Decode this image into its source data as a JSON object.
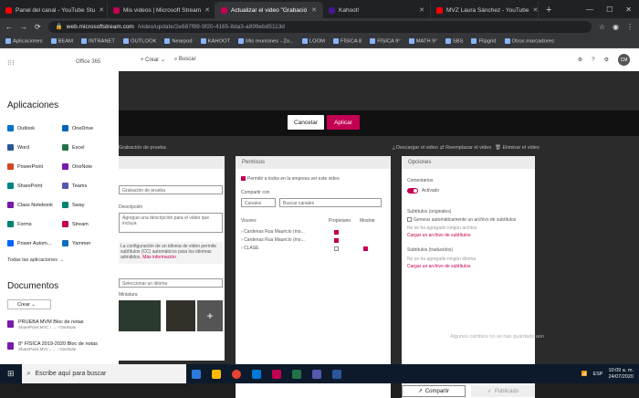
{
  "browser": {
    "tabs": [
      {
        "title": "Panel del canal - YouTube Stu",
        "color": "#ff0000",
        "active": false
      },
      {
        "title": "Mis videos | Microsoft Stream",
        "color": "#c30052",
        "active": false
      },
      {
        "title": "Actualizar el video \"Grabació",
        "color": "#c30052",
        "active": true
      },
      {
        "title": "Kahoot!",
        "color": "#46178f",
        "active": false
      },
      {
        "title": "MVZ Laura Sánchez - YouTube",
        "color": "#ff0000",
        "active": false
      }
    ],
    "url_host": "web.microsoftstream.com",
    "url_path": "/video/update/2e887f89-9f20-4165-8da3-a899ebd5113d",
    "bookmarks": [
      "Aplicaciones",
      "BEAM",
      "INTRANET",
      "OUTLOOK",
      "Nearpod",
      "KAHOOT",
      "Mis reuniones - Zo...",
      "LOOM",
      "FÍSICA 8",
      "FÍSICA 9°",
      "MATH 9°",
      "SBS",
      "Flipgrid",
      "Otros marcadores"
    ]
  },
  "app_launcher": {
    "brand": "Office 365",
    "apps_title": "Aplicaciones",
    "apps": [
      {
        "name": "Outlook",
        "color": "#0072c6"
      },
      {
        "name": "OneDrive",
        "color": "#0364b8"
      },
      {
        "name": "Word",
        "color": "#2b579a"
      },
      {
        "name": "Excel",
        "color": "#217346"
      },
      {
        "name": "PowerPoint",
        "color": "#d24726"
      },
      {
        "name": "OneNote",
        "color": "#7719aa"
      },
      {
        "name": "SharePoint",
        "color": "#038387"
      },
      {
        "name": "Teams",
        "color": "#5558af"
      },
      {
        "name": "Class Notebook",
        "color": "#7719aa"
      },
      {
        "name": "Sway",
        "color": "#008272"
      },
      {
        "name": "Forms",
        "color": "#008272"
      },
      {
        "name": "Stream",
        "color": "#c30052"
      },
      {
        "name": "Power Autom...",
        "color": "#0066ff"
      },
      {
        "name": "Yammer",
        "color": "#106ebe"
      }
    ],
    "all_apps": "Todas las aplicaciones",
    "docs_title": "Documentos",
    "create_label": "Crear",
    "docs": [
      {
        "name": "PRUEBA MVM Bloc de notas",
        "meta": "SharePoint MVC › ... › OneNote"
      },
      {
        "name": "8° FÍSICA 2019-2020 Bloc de notas",
        "meta": "SharePoint MVC › ... › OneNote"
      }
    ]
  },
  "stream": {
    "create": "Crear",
    "search_placeholder": "Buscar",
    "cancel": "Cancelar",
    "apply": "Aplicar",
    "video_title": "Grabación de prueba",
    "download": "Descargar el video",
    "replace": "Reemplazar el video",
    "delete": "Eliminar el video",
    "details": {
      "name_value": "Grabación de prueba",
      "desc_label": "Descripción",
      "desc_placeholder": "Agregue una descripción para el video que incluya",
      "lang_note": "La configuración de un idioma de video permite subtítulos (CC) automáticos para los idiomas admitidos.",
      "more_info": "Más información",
      "thumb_label": "Miniatura",
      "lang_select": "Seleccionar un idioma"
    },
    "permissions": {
      "title": "Permisos",
      "allow_all": "Permitir a todos en la empresa ver este video",
      "share_label": "Compartir con",
      "share_select": "Canales",
      "search": "Buscar canales",
      "col_viewers": "Visores",
      "col_owner": "Propietario",
      "col_display": "Mostrar",
      "rows": [
        "Cardenas Rua Mauricio (mo...",
        "Cardenas Rua Mauricio (mo...",
        "CLASE"
      ]
    },
    "options": {
      "title": "Opciones",
      "comments": "Comentarios",
      "comments_state": "Activado",
      "subs": "Subtítulos (originales)",
      "auto_subs": "Generar automáticamente un archivo de subtítulos",
      "no_file": "No se ha agregado ningún archivo",
      "upload_subs": "Cargar un archivo de subtítulos",
      "trans": "Subtítulos (traducidos)",
      "no_lang": "No se ha agregado ningún idioma",
      "upload_trans": "Cargar un archivo de subtítulos"
    },
    "share_btn": "Compartir",
    "published": "Publicado",
    "saved_note": "Algunos cambios no se han guardado aún"
  },
  "taskbar": {
    "search": "Escribe aquí para buscar",
    "lang": "ESP",
    "time": "10:09 a. m.",
    "date": "24/07/2020"
  }
}
